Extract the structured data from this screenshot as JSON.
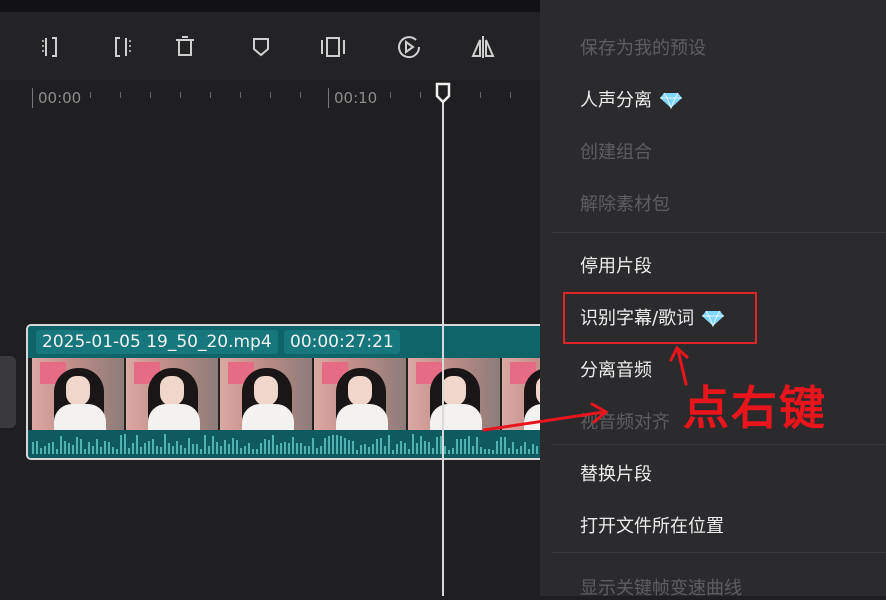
{
  "timeline": {
    "ruler": {
      "label_0": "00:00",
      "label_1": "00:10"
    },
    "clip": {
      "filename": "2025-01-05 19_50_20.mp4",
      "duration": "00:00:27:21"
    }
  },
  "toolbar": {
    "icons": [
      "split-left-icon",
      "split-right-icon",
      "delete-icon",
      "marker-icon",
      "freeze-frame-icon",
      "play-circle-icon",
      "mirror-icon"
    ]
  },
  "context_menu": {
    "items": [
      {
        "label": "保存为我的预设",
        "enabled": false
      },
      {
        "label": "人声分离",
        "enabled": true,
        "vip": true
      },
      {
        "label": "创建组合",
        "enabled": false
      },
      {
        "label": "解除素材包",
        "enabled": false
      },
      {
        "label": "停用片段",
        "enabled": true
      },
      {
        "label": "识别字幕/歌词",
        "enabled": true,
        "vip": true
      },
      {
        "label": "分离音频",
        "enabled": true
      },
      {
        "label": "视音频对齐",
        "enabled": false
      },
      {
        "label": "替换片段",
        "enabled": true
      },
      {
        "label": "打开文件所在位置",
        "enabled": true
      },
      {
        "label": "显示关键帧变速曲线",
        "enabled": false
      }
    ]
  },
  "annotation": {
    "text": "点右键",
    "color": "#e8151c"
  },
  "colors": {
    "clip_teal": "#0f5e63",
    "menu_bg": "#2b2b2d",
    "accent_red": "#e0242a",
    "vip_gem": "#7fd6ff"
  }
}
